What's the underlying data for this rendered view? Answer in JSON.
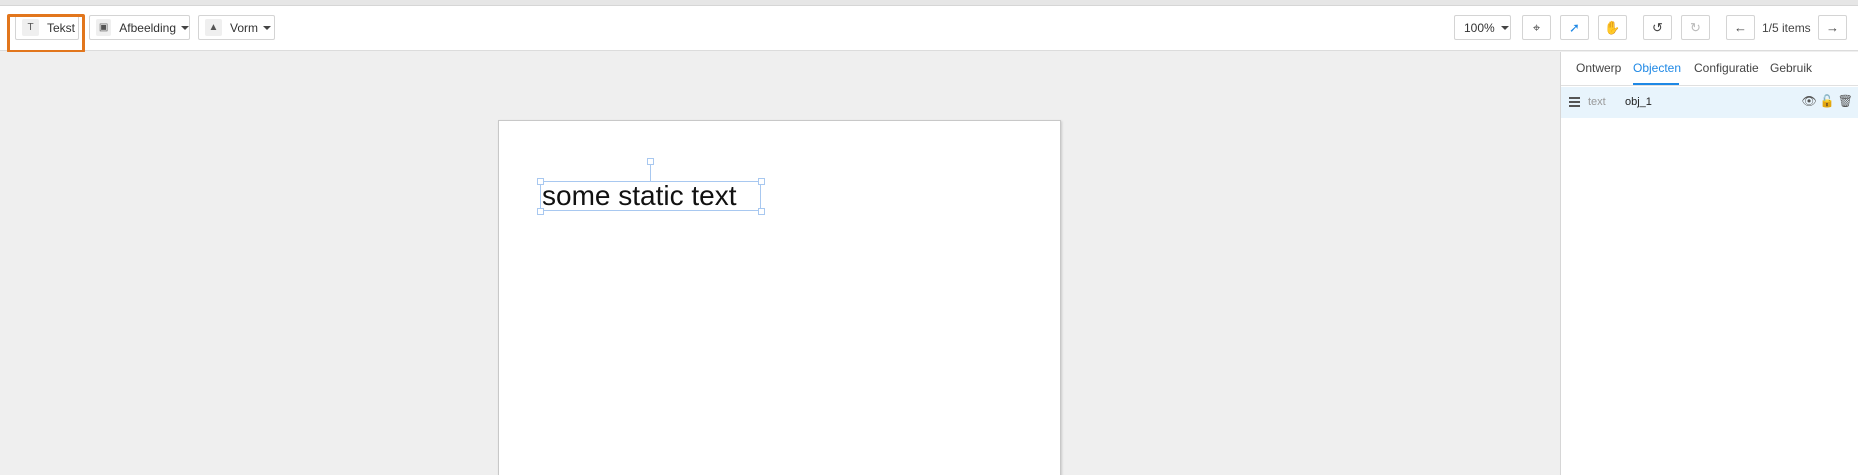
{
  "toolbar": {
    "text_button": {
      "label": "Tekst",
      "icon": "text-icon"
    },
    "image_button": {
      "label": "Afbeelding",
      "icon": "image-icon"
    },
    "shape_button": {
      "label": "Vorm",
      "icon": "shape-icon"
    },
    "zoom": "100%",
    "item_counter": "1/5 items"
  },
  "canvas": {
    "text_object": "some static text"
  },
  "panel": {
    "tabs": [
      "Ontwerp",
      "Objecten",
      "Configuratie",
      "Gebruik"
    ],
    "active_tab": "Objecten",
    "objects": [
      {
        "type": "text",
        "name": "obj_1"
      }
    ]
  },
  "colors": {
    "accent": "#1e88e5",
    "highlight": "#e2761c",
    "selection": "#a8c8f0",
    "row_selected": "#e8f4fc"
  }
}
